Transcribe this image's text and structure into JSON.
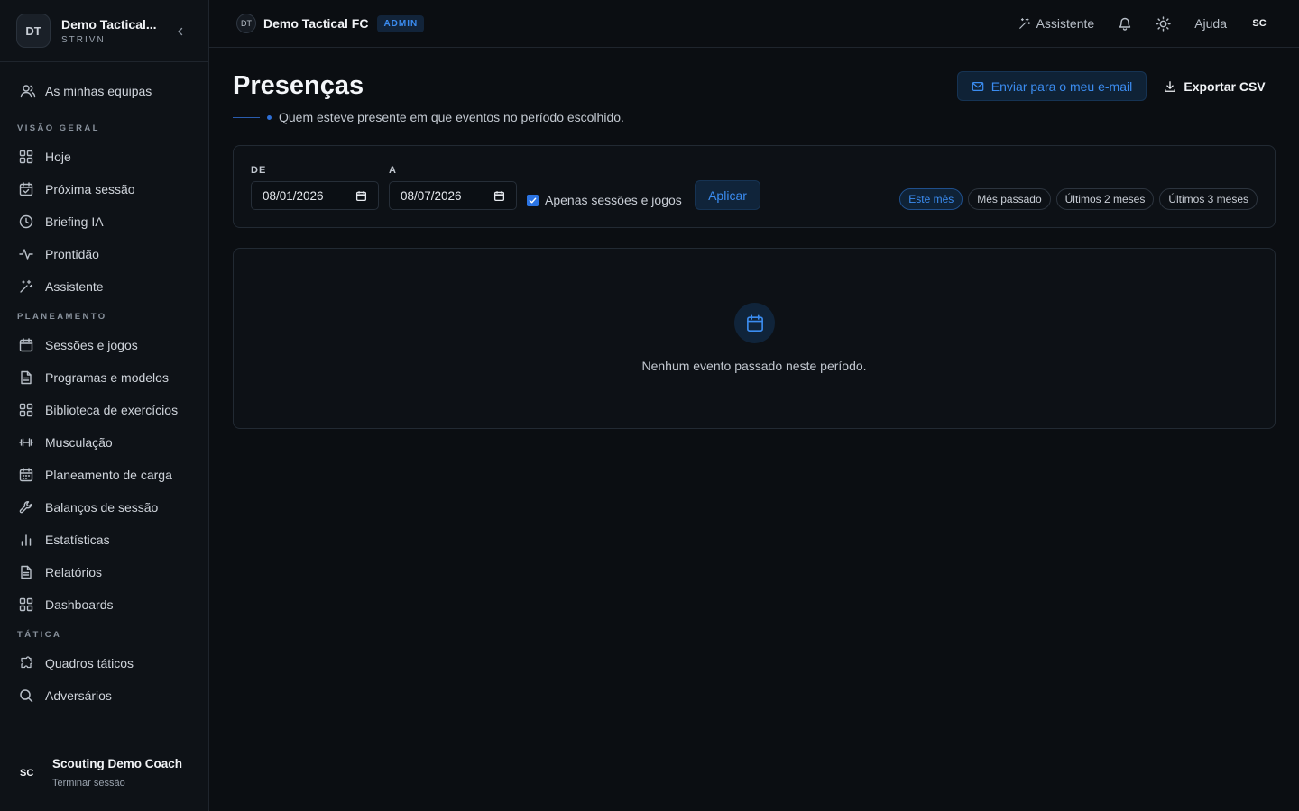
{
  "sidebar": {
    "team_initials": "DT",
    "team_name": "Demo Tactical...",
    "team_sub": "STRIVN",
    "my_teams": "As minhas equipas",
    "sections": {
      "overview": "VISÃO GERAL",
      "planning": "PLANEAMENTO",
      "tactics": "TÁTICA"
    },
    "overview_items": [
      {
        "label": "Hoje",
        "icon": "grid-icon"
      },
      {
        "label": "Próxima sessão",
        "icon": "calendar-check-icon"
      },
      {
        "label": "Briefing IA",
        "icon": "clock-icon"
      },
      {
        "label": "Prontidão",
        "icon": "activity-icon"
      },
      {
        "label": "Assistente",
        "icon": "sparkles-icon"
      }
    ],
    "planning_items": [
      {
        "label": "Sessões e jogos",
        "icon": "calendar-icon"
      },
      {
        "label": "Programas e modelos",
        "icon": "document-icon"
      },
      {
        "label": "Biblioteca de exercícios",
        "icon": "grid-icon"
      },
      {
        "label": "Musculação",
        "icon": "dumbbell-icon"
      },
      {
        "label": "Planeamento de carga",
        "icon": "calendar-grid-icon"
      },
      {
        "label": "Balanços de sessão",
        "icon": "wrench-icon"
      },
      {
        "label": "Estatísticas",
        "icon": "bar-chart-icon"
      },
      {
        "label": "Relatórios",
        "icon": "document-icon"
      },
      {
        "label": "Dashboards",
        "icon": "grid-icon"
      }
    ],
    "tactics_items": [
      {
        "label": "Quadros táticos",
        "icon": "puzzle-icon"
      },
      {
        "label": "Adversários",
        "icon": "search-icon"
      }
    ],
    "user_initials": "SC",
    "user_name": "Scouting Demo Coach",
    "logout": "Terminar sessão"
  },
  "topbar": {
    "team_initials": "DT",
    "team_name": "Demo Tactical FC",
    "role_badge": "ADMIN",
    "assistant": "Assistente",
    "help": "Ajuda",
    "user_initials": "SC"
  },
  "page": {
    "title": "Presenças",
    "subtitle": "Quem esteve presente em que eventos no período escolhido.",
    "email_button": "Enviar para o meu e-mail",
    "csv_button": "Exportar CSV"
  },
  "filters": {
    "from_label": "DE",
    "to_label": "A",
    "from_value": "08/01/2026",
    "to_value": "08/07/2026",
    "checkbox_label": "Apenas sessões e jogos",
    "checkbox_checked": true,
    "apply": "Aplicar",
    "presets": [
      "Este mês",
      "Mês passado",
      "Últimos 2 meses",
      "Últimos 3 meses"
    ],
    "active_preset": "Este mês"
  },
  "empty_state": {
    "message": "Nenhum evento passado neste período.",
    "icon": "calendar-icon"
  },
  "colors": {
    "accent": "#3b8cf0",
    "background": "#0b0e12",
    "sidebar": "#0e1217"
  }
}
